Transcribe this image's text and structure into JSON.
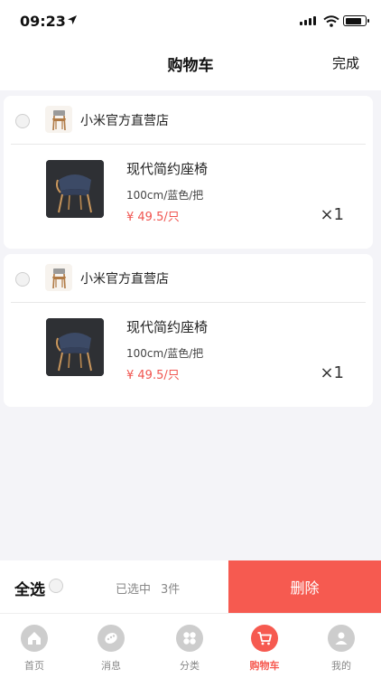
{
  "status_bar": {
    "time": "09:23"
  },
  "nav": {
    "title": "购物车",
    "action": "完成"
  },
  "cart": {
    "stores": [
      {
        "store_name": "小米官方直营店",
        "product": {
          "name": "现代简约座椅",
          "spec": "100cm/蓝色/把",
          "price": "¥ 49.5/只",
          "quantity": "×1"
        }
      },
      {
        "store_name": "小米官方直营店",
        "product": {
          "name": "现代简约座椅",
          "spec": "100cm/蓝色/把",
          "price": "¥ 49.5/只",
          "quantity": "×1"
        }
      }
    ]
  },
  "bottom_bar": {
    "select_all": "全选",
    "selected_label": "已选中",
    "selected_count": "3件",
    "delete": "删除"
  },
  "tabs": [
    {
      "label": "首页",
      "icon": "home-icon",
      "active": false
    },
    {
      "label": "消息",
      "icon": "message-icon",
      "active": false
    },
    {
      "label": "分类",
      "icon": "category-icon",
      "active": false
    },
    {
      "label": "购物车",
      "icon": "cart-icon",
      "active": true
    },
    {
      "label": "我的",
      "icon": "profile-icon",
      "active": false
    }
  ],
  "colors": {
    "accent": "#f65a50",
    "price": "#f0544f",
    "background": "#f4f4f8",
    "tab_inactive": "#cdcdcd"
  }
}
